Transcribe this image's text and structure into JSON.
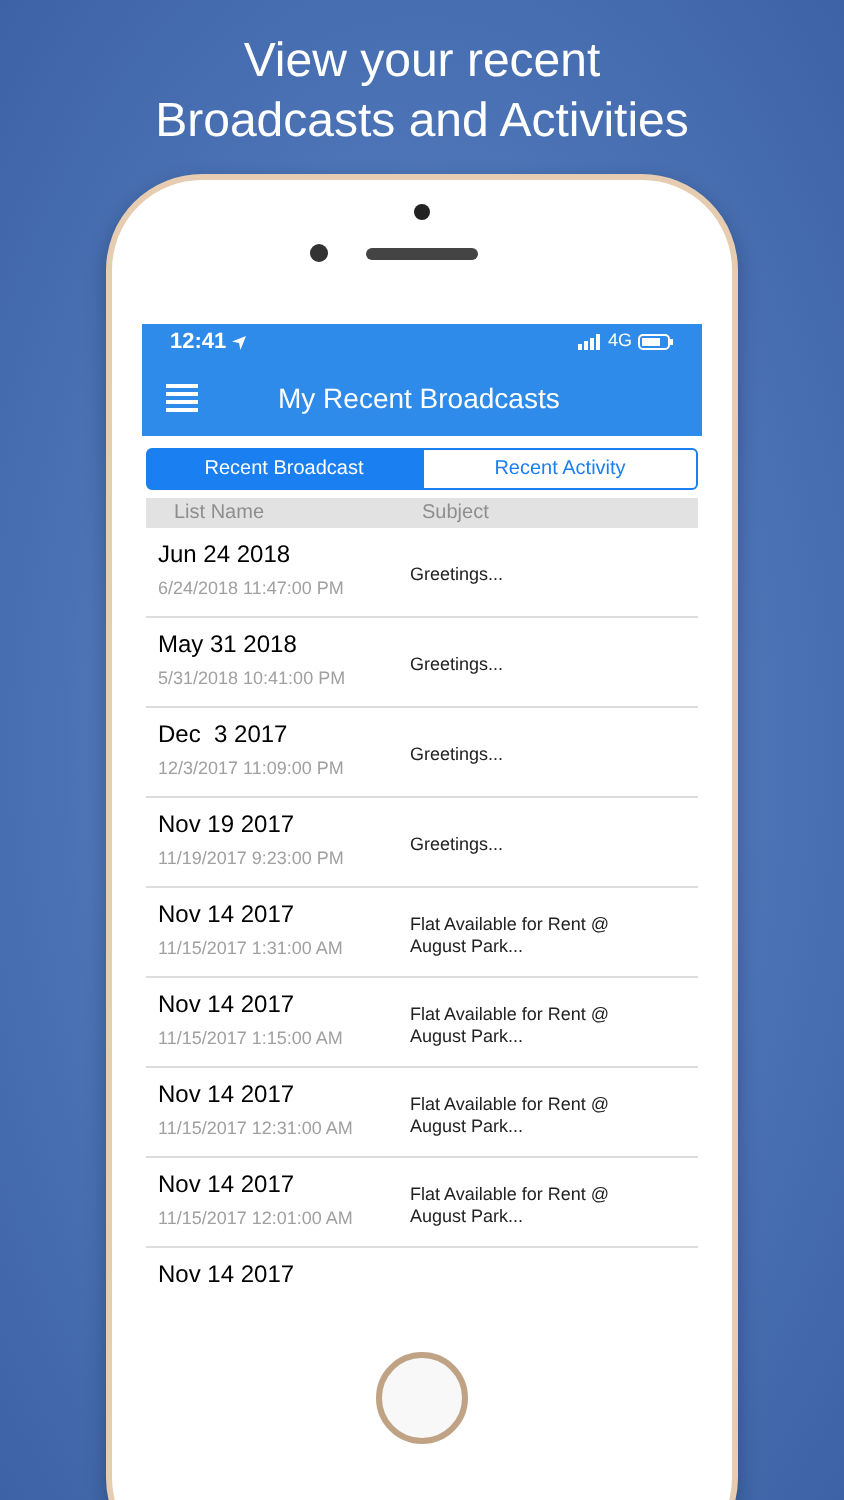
{
  "headline": [
    "View your recent",
    "Broadcasts and Activities"
  ],
  "status_bar": {
    "time": "12:41",
    "network": "4G"
  },
  "nav_bar": {
    "title": "My Recent Broadcasts"
  },
  "tabs": [
    {
      "label": "Recent Broadcast",
      "selected": true
    },
    {
      "label": "Recent Activity",
      "selected": false
    }
  ],
  "table": {
    "columns": [
      "List Name",
      "Subject"
    ],
    "rows": [
      {
        "date": "Jun 24 2018",
        "timestamp": "6/24/2018 11:47:00 PM",
        "subject": "Greetings..."
      },
      {
        "date": "May 31 2018",
        "timestamp": "5/31/2018 10:41:00 PM",
        "subject": "Greetings..."
      },
      {
        "date": "Dec  3 2017",
        "timestamp": "12/3/2017 11:09:00 PM",
        "subject": "Greetings..."
      },
      {
        "date": "Nov 19 2017",
        "timestamp": "11/19/2017 9:23:00 PM",
        "subject": "Greetings..."
      },
      {
        "date": "Nov 14 2017",
        "timestamp": "11/15/2017 1:31:00 AM",
        "subject": "Flat Available for Rent @ August Park..."
      },
      {
        "date": "Nov 14 2017",
        "timestamp": "11/15/2017 1:15:00 AM",
        "subject": "Flat Available for Rent @ August Park..."
      },
      {
        "date": "Nov 14 2017",
        "timestamp": "11/15/2017 12:31:00 AM",
        "subject": "Flat Available for Rent @ August Park..."
      },
      {
        "date": "Nov 14 2017",
        "timestamp": "11/15/2017 12:01:00 AM",
        "subject": "Flat Available for Rent @ August Park..."
      },
      {
        "date": "Nov 14 2017"
      }
    ]
  }
}
